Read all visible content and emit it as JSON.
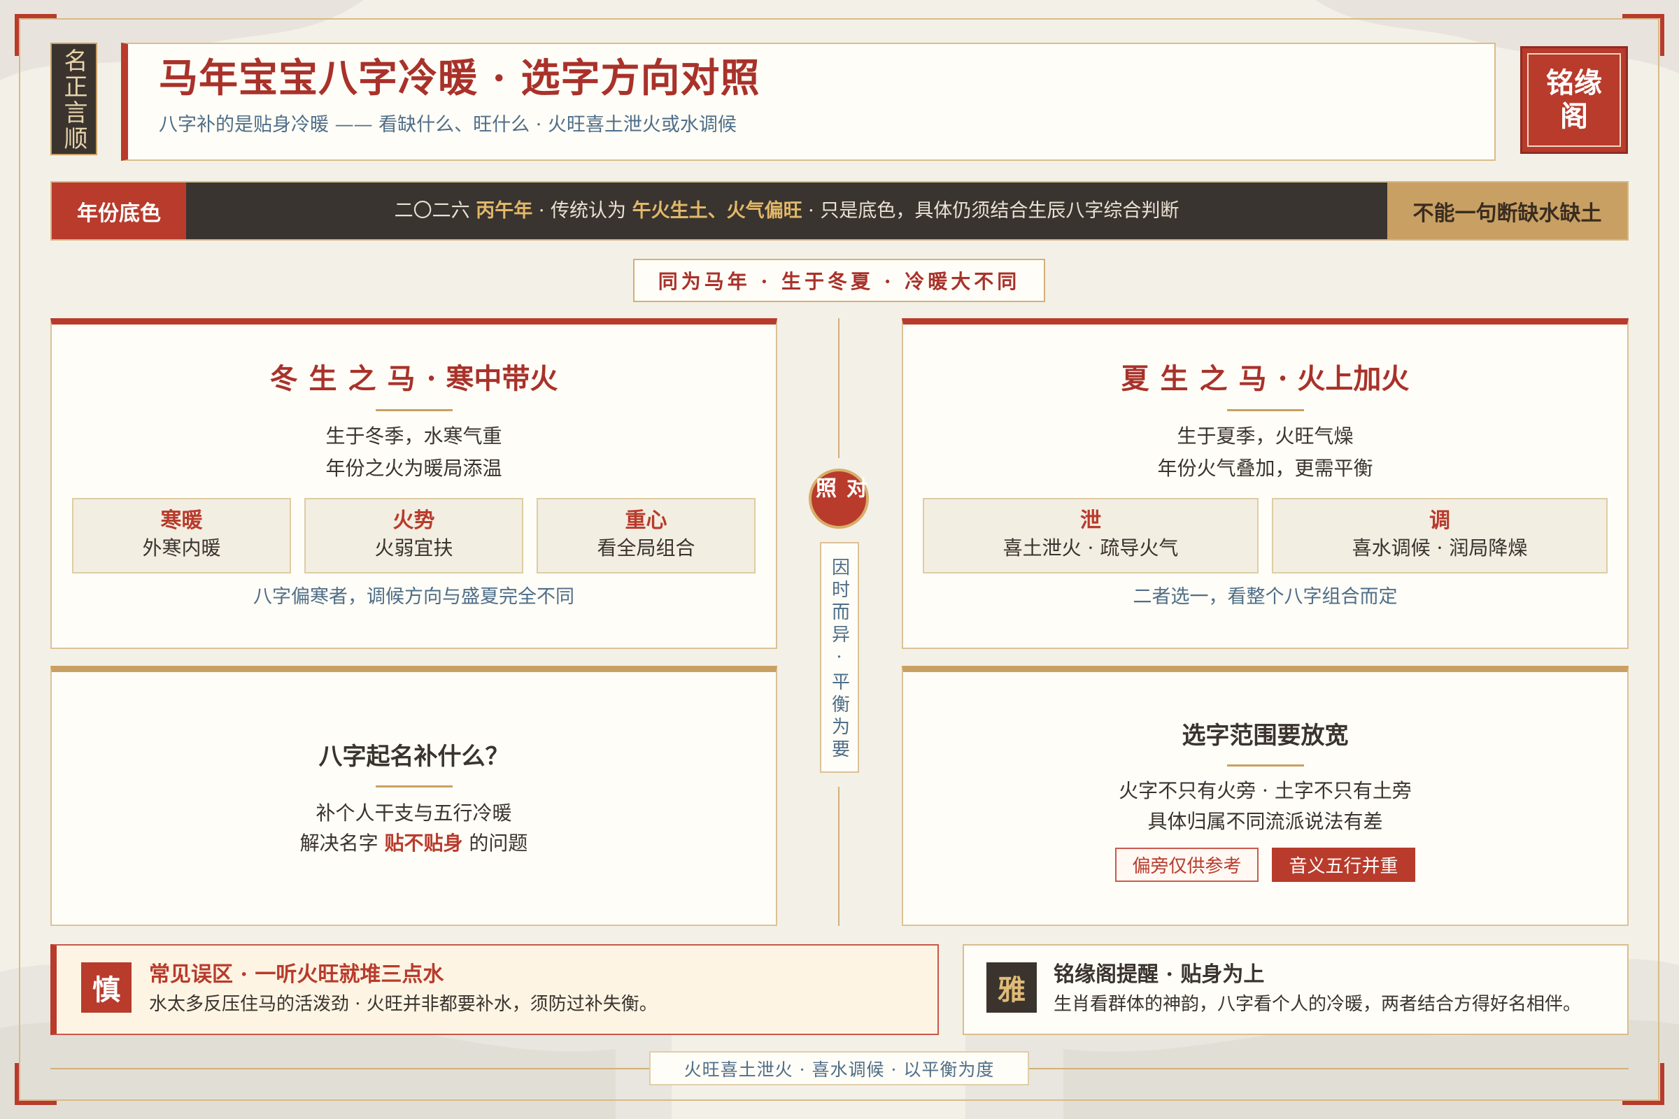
{
  "colors": {
    "accent_red": "#b83b2c",
    "accent_gold": "#c9a063",
    "ink_dark": "#3b342e",
    "paper": "#fffdf7",
    "note_blue": "#4f6e88"
  },
  "side_badge": "名正言顺",
  "header": {
    "title": "马年宝宝八字冷暖 · 选字方向对照",
    "subtitle": "八字补的是贴身冷暖 —— 看缺什么、旺什么 · 火旺喜土泄火或水调候"
  },
  "seal": {
    "line1": "铭缘",
    "line2": "阁"
  },
  "banner": {
    "label": "年份底色",
    "text": {
      "p1": "二〇二六 ",
      "h1": "丙午年",
      "p2": " · 传统认为 ",
      "h2": "午火生土、火气偏旺",
      "p3": " · 只是底色，具体仍须结合生辰八字综合判断"
    },
    "note": "不能一句断缺水缺土"
  },
  "compare_label": "同为马年 · 生于冬夏 · 冷暖大不同",
  "divider": {
    "badge": "对照",
    "motto": "因时而异·平衡为要"
  },
  "winter_card": {
    "title_name": "冬生之马",
    "title_theme": "· 寒中带火",
    "lines": [
      "生于冬季，水寒气重",
      "年份之火为暖局添温"
    ],
    "tiles": [
      {
        "label": "寒暖",
        "text": "外寒内暖"
      },
      {
        "label": "火势",
        "text": "火弱宜扶"
      },
      {
        "label": "重心",
        "text": "看全局组合"
      }
    ],
    "footnote": "八字偏寒者，调候方向与盛夏完全不同"
  },
  "summer_card": {
    "title_name": "夏生之马",
    "title_theme": "· 火上加火",
    "lines": [
      "生于夏季，火旺气燥",
      "年份火气叠加，更需平衡"
    ],
    "tiles": [
      {
        "label": "泄",
        "text": "喜土泄火 · 疏导火气"
      },
      {
        "label": "调",
        "text": "喜水调候 · 润局降燥"
      }
    ],
    "footnote": "二者选一，看整个八字组合而定"
  },
  "purpose_card": {
    "title": "八字起名补什么？",
    "line1": "补个人干支与五行冷暖",
    "line2": {
      "before": "解决名字 ",
      "highlight": "贴不贴身",
      "after": " 的问题"
    }
  },
  "scope_card": {
    "title": "选字范围要放宽",
    "lines": [
      "火字不只有火旁 · 土字不只有土旁",
      "具体归属不同流派说法有差"
    ],
    "tags": [
      "偏旁仅供参考",
      "音义五行并重"
    ]
  },
  "warning": {
    "badge": "慎",
    "title": "常见误区 · 一听火旺就堆三点水",
    "text": "水太多反压住马的活泼劲 · 火旺并非都要补水，须防过补失衡。"
  },
  "reminder": {
    "badge": "雅",
    "title": "铭缘阁提醒 · 贴身为上",
    "text": "生肖看群体的神韵，八字看个人的冷暖，两者结合方得好名相伴。"
  },
  "footer": "火旺喜土泄火 · 喜水调候 · 以平衡为度"
}
